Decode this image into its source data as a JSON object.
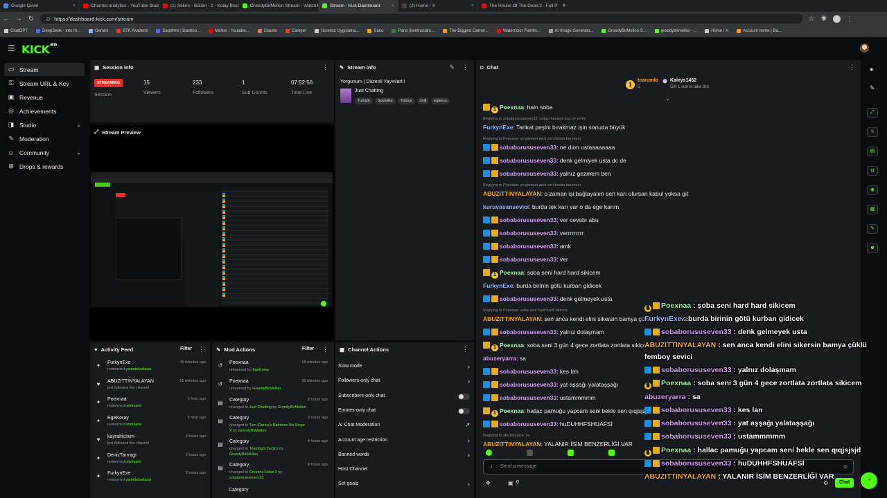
{
  "browser": {
    "tabs": [
      {
        "label": "Google Çeviri",
        "color": "#4285f4"
      },
      {
        "label": "Channel analytics - YouTube Studio",
        "color": "#ff0000"
      },
      {
        "label": "(1) Sekiro - Bölüm - 2 - Kolay Boss",
        "color": "#ff0000"
      },
      {
        "label": "GreedyBirMellon Stream - Watch L",
        "color": "#53fc18"
      },
      {
        "label": "Stream - Kick Dashboard",
        "color": "#53fc18"
      },
      {
        "label": "(2) Home / X",
        "color": "#444444"
      },
      {
        "label": "The House Of The Dead 2 - Full Pl",
        "color": "#ff0000"
      }
    ],
    "url": "https://dashboard.kick.com/stream",
    "bookmarks": [
      {
        "label": "ChatGPT",
        "color": "#cfcfcf"
      },
      {
        "label": "DeepSeek - Into th...",
        "color": "#4d6bfe"
      },
      {
        "label": "Gemini",
        "color": "#8ab4f8"
      },
      {
        "label": "BTK Akademi",
        "color": "#e53935"
      },
      {
        "label": "Sapphire | Dashbo...",
        "color": "#5865f2"
      },
      {
        "label": "Mellon - Youtube...",
        "color": "#ff0000"
      },
      {
        "label": "Claude",
        "color": "#d97757"
      },
      {
        "label": "Camper",
        "color": "#e53935"
      },
      {
        "label": "Ücretsiz Uygulama...",
        "color": "#cfcfcf"
      },
      {
        "label": "Suno",
        "color": "#f7a600"
      },
      {
        "label": "Pano (bentrendim...",
        "color": "#2e7d32"
      },
      {
        "label": "The Biggest Gamer...",
        "color": "#ff9800"
      },
      {
        "label": "Watercolor Paintin...",
        "color": "#ff0000"
      },
      {
        "label": "AI Image Generato...",
        "color": "#9e9e9e"
      },
      {
        "label": "GreedyBirMellon S...",
        "color": "#53fc18"
      },
      {
        "label": "greedybirmellon -...",
        "color": "#53fc18"
      },
      {
        "label": "Home / X",
        "color": "#cfcfcf"
      },
      {
        "label": "Account home | Ba...",
        "color": "#ff9800"
      }
    ]
  },
  "brand": {
    "logo": "KICK",
    "beta": "BETA",
    "accent": "#53fc18"
  },
  "sidebar": [
    {
      "label": "Stream",
      "icon": "stream-icon",
      "glyph": "▭"
    },
    {
      "label": "Stream URL & Key",
      "icon": "key-icon",
      "glyph": "⚿"
    },
    {
      "label": "Revenue",
      "icon": "revenue-icon",
      "glyph": "▣"
    },
    {
      "label": "Achievements",
      "icon": "achievements-icon",
      "glyph": "◎"
    },
    {
      "label": "Studio",
      "icon": "studio-icon",
      "glyph": "◨"
    },
    {
      "label": "Moderation",
      "icon": "moderation-icon",
      "glyph": "✎"
    },
    {
      "label": "Community",
      "icon": "community-icon",
      "glyph": "☺"
    },
    {
      "label": "Drops & rewards",
      "icon": "drops-icon",
      "glyph": "⊞"
    }
  ],
  "session": {
    "title": "Session Info",
    "badge": "STREAMING",
    "badge_label": "Session",
    "stats": [
      {
        "value": "15",
        "label": "Viewers"
      },
      {
        "value": "233",
        "label": "Followers"
      },
      {
        "value": "1",
        "label": "Sub Counts"
      },
      {
        "value": "07:52:56",
        "label": "Time Live"
      }
    ]
  },
  "stream_info": {
    "title": "Stream info",
    "stream_title": "Yorgunum | Düzenli Yayınlar!!!",
    "category": "Just Chatting",
    "tags": [
      "Turkish",
      "Soulslike",
      "Türkçe",
      "chill",
      "eglence"
    ]
  },
  "preview": {
    "title": "Stream Preview"
  },
  "activity": {
    "title": "Activity Feed",
    "filter": "Filter",
    "items": [
      {
        "name": "FurkynExe",
        "pre": "redeemed ",
        "hl": "yametekudasai",
        "time": "45 minutes ago",
        "icon": "redeem-icon",
        "glyph": "✦"
      },
      {
        "name": "ABUZITTINYALAYAN",
        "pre": "just followed the channel",
        "hl": "",
        "time": "55 minutes ago",
        "icon": "heart-icon",
        "glyph": "♥"
      },
      {
        "name": "Poexnaa",
        "pre": "redeemed ",
        "hl": "isteksarkı",
        "time": "1 hour ago",
        "icon": "redeem-icon",
        "glyph": "✦"
      },
      {
        "name": "EgeKoray",
        "pre": "redeemed ",
        "hl": "isteksarkı",
        "time": "1 hour ago",
        "icon": "redeem-icon",
        "glyph": "✦"
      },
      {
        "name": "kayralricsvm",
        "pre": "just followed the channel",
        "hl": "",
        "time": "2 hours ago",
        "icon": "heart-icon",
        "glyph": "♥"
      },
      {
        "name": "DenizTarrragi",
        "pre": "redeemed ",
        "hl": "isteksarkı",
        "time": "2 hours ago",
        "icon": "redeem-icon",
        "glyph": "✦"
      },
      {
        "name": "FurkynExe",
        "pre": "redeemed ",
        "hl": "yametekudasai",
        "time": "2 hours ago",
        "icon": "redeem-icon",
        "glyph": "✦"
      }
    ]
  },
  "mod_actions": {
    "title": "Mod Actions",
    "filter": "Filter",
    "items": [
      {
        "name": "Poexnaa",
        "line1": "unbanned by ",
        "hl1": "EgeKoray",
        "line2": "",
        "time": "18 minutes ago",
        "glyph": "↺"
      },
      {
        "name": "Poexnaa",
        "line1": "unbanned by ",
        "hl1": "GreedyBirMellon",
        "line2": "",
        "time": "30 minutes ago",
        "glyph": "↺"
      },
      {
        "name": "Category",
        "line1": "changed to ",
        "hl1": "Just Chatting",
        "mid": " by ",
        "hl2": "GreedyBirMellon",
        "time": "2 hours ago",
        "glyph": "▤"
      },
      {
        "name": "Category",
        "line1": "changed to ",
        "hl1": "Tom Clancy's Rainbow Six Siege X",
        "mid": " by ",
        "hl2": "GreedyBirMellon",
        "time": "3 hours ago",
        "glyph": "▤"
      },
      {
        "name": "Category",
        "line1": "changed to ",
        "hl1": "Teamfight Tactics",
        "mid": " by ",
        "hl2": "GreedyBirMellon",
        "time": "4 hours ago",
        "glyph": "▤"
      },
      {
        "name": "Category",
        "line1": "changed to ",
        "hl1": "Counter-Strike 2",
        "mid": " by ",
        "hl2": "sobaborususeven33",
        "time": "6 hours ago",
        "glyph": "▤"
      }
    ],
    "cut_item": "Category"
  },
  "channel_actions": {
    "title": "Channel Actions",
    "items": [
      {
        "label": "Slow mode",
        "ctl": "chevron"
      },
      {
        "label": "Followers-only chat",
        "ctl": "chevron"
      },
      {
        "label": "Subscribers-only chat",
        "ctl": "toggle"
      },
      {
        "label": "Emotes-only chat",
        "ctl": "toggle"
      },
      {
        "label": "AI Chat Moderation",
        "ctl": "link"
      },
      {
        "label": "Account age restriction",
        "ctl": "chevron"
      },
      {
        "label": "Banned words",
        "ctl": "chevron"
      },
      {
        "label": "Host Channel",
        "ctl": "none"
      },
      {
        "label": "Set goals",
        "ctl": "chevron"
      }
    ]
  },
  "chat": {
    "title": "Chat",
    "top_gifters": [
      {
        "name": "tearundo",
        "sub": "5"
      },
      {
        "name": "Kaleys1452",
        "sub": "Gift 1 sub to take 3rd"
      }
    ],
    "messages": [
      {
        "reply": "",
        "badges": [
          "gold",
          "yellow"
        ],
        "user": "Poexnaa",
        "color": "#9cf3a3",
        "text": ": hain soba"
      },
      {
        "reply": "Replying to sobaborususeven33: ustayı kesseni kaç yıl yerim",
        "badges": [],
        "user": "FurkynExe",
        "color": "#8fb3ff",
        "text": ": Tarikat peşini bırakmaz işin sonuda büyük"
      },
      {
        "reply": "Replying to Poexnaa: yo gitmem artık sen benim karımsın",
        "badges": [
          "blue",
          "gold"
        ],
        "user": "sobaborususeven33",
        "color": "#d49cf6",
        "text": ": ne dion ustaaaaaaaa"
      },
      {
        "reply": "",
        "badges": [
          "blue",
          "gold"
        ],
        "user": "sobaborususeven33",
        "color": "#d49cf6",
        "text": ": denk gelmiyek usta dc de"
      },
      {
        "reply": "",
        "badges": [
          "blue",
          "gold"
        ],
        "user": "sobaborususeven33",
        "color": "#d49cf6",
        "text": ": yalnız gezmem ben"
      },
      {
        "reply": "Replying to Poexnaa: yo gitmem artık sen benim karımsın",
        "badges": [],
        "user": "ABUZITTINYALAYAN",
        "color": "#f5a623",
        "text": ": o zaman işi bağlayalım sen karı olursan kabul yoksa git"
      },
      {
        "reply": "",
        "badges": [],
        "user": "kuruvasansevici",
        "color": "#8fb3ff",
        "text": ": burda tek karı var o da ege karım"
      },
      {
        "reply": "",
        "badges": [
          "blue",
          "gold"
        ],
        "user": "sobaborususeven33",
        "color": "#d49cf6",
        "text": ": ver cevabı abu"
      },
      {
        "reply": "",
        "badges": [
          "blue",
          "gold"
        ],
        "user": "sobaborususeven33",
        "color": "#d49cf6",
        "text": ": verrrrrrrrr"
      },
      {
        "reply": "",
        "badges": [
          "blue",
          "gold"
        ],
        "user": "sobaborususeven33",
        "color": "#d49cf6",
        "text": ": amk"
      },
      {
        "reply": "",
        "badges": [
          "blue",
          "gold"
        ],
        "user": "sobaborususeven33",
        "color": "#d49cf6",
        "text": ": ver"
      },
      {
        "reply": "",
        "badges": [
          "gold",
          "yellow"
        ],
        "user": "Poexnaa",
        "color": "#9cf3a3",
        "text": ": soba seni hard hard sikicem"
      },
      {
        "reply": "",
        "badges": [],
        "user": "FurkynExe",
        "color": "#8fb3ff",
        "text": ": burda birinin götü kurban gidicek"
      },
      {
        "reply": "",
        "badges": [
          "blue",
          "gold"
        ],
        "user": "sobaborususeven33",
        "color": "#d49cf6",
        "text": ": denk gelmeyek usta"
      },
      {
        "reply": "Replying to Poexnaa: soba seni hard hard sikicem",
        "badges": [],
        "user": "ABUZITTINYALAYAN",
        "color": "#f5a623",
        "text": ": sen anca kendi elini sikersin bamya çüklü femboy sevici"
      },
      {
        "reply": "",
        "badges": [
          "blue",
          "gold"
        ],
        "user": "sobaborususeven33",
        "color": "#d49cf6",
        "text": ": yalnız dolaşmam"
      },
      {
        "reply": "",
        "badges": [
          "gold",
          "yellow"
        ],
        "user": "Poexnaa",
        "color": "#9cf3a3",
        "text": ": soba seni 3 gün 4 gece zortlata zortlata sikicem"
      },
      {
        "reply": "",
        "badges": [],
        "user": "abuzeryarra",
        "color": "#d49cf6",
        "text": ": sa"
      },
      {
        "reply": "",
        "badges": [
          "blue",
          "gold"
        ],
        "user": "sobaborususeven33",
        "color": "#d49cf6",
        "text": ": kes lan"
      },
      {
        "reply": "",
        "badges": [
          "blue",
          "gold"
        ],
        "user": "sobaborususeven33",
        "color": "#d49cf6",
        "text": ": yat aşşağı yalataşşağı"
      },
      {
        "reply": "",
        "badges": [
          "blue",
          "gold"
        ],
        "user": "sobaborususeven33",
        "color": "#d49cf6",
        "text": ": ustammmmm"
      },
      {
        "reply": "",
        "badges": [
          "gold",
          "yellow"
        ],
        "user": "Poexnaa",
        "color": "#9cf3a3",
        "text": ": hallac pamuğu yapcam seni bekle sen qıqjsjsjd"
      },
      {
        "reply": "",
        "badges": [
          "blue",
          "gold"
        ],
        "user": "sobaborususeven33",
        "color": "#d49cf6",
        "text": ": huDUHHFSHUAFSİ"
      },
      {
        "reply": "Replying to abuzeryarra: sa",
        "badges": [],
        "user": "ABUZITTINYALAYAN",
        "color": "#f5a623",
        "text": ": YALANIR İSİM BENZERLİĞİ VAR"
      }
    ],
    "input_placeholder": "Send a message",
    "send_label": "Chat",
    "footer_count": "0"
  },
  "overlay": [
    {
      "badges": [
        "yellow",
        "gold"
      ],
      "user": "Poexnaa",
      "color": "#9cf3a3",
      "text": " : soba seni hard hard sikicem"
    },
    {
      "badges": [],
      "user": "FurkynExe",
      "color": "#8fb3ff",
      "text": " : burda birinin götü kurban gidicek"
    },
    {
      "badges": [
        "blue",
        "gold"
      ],
      "user": "sobaborususeven33",
      "color": "#d49cf6",
      "text": " : denk gelmeyek usta"
    },
    {
      "badges": [],
      "user": "ABUZITTINYALAYAN",
      "color": "#f5a623",
      "text": " : sen anca kendi elini sikersin bamya çüklü"
    },
    {
      "badges": [],
      "user": "",
      "color": "#ffffff",
      "text": "femboy sevici"
    },
    {
      "badges": [
        "blue",
        "gold"
      ],
      "user": "sobaborususeven33",
      "color": "#d49cf6",
      "text": " : yalnız dolaşmam"
    },
    {
      "badges": [
        "yellow",
        "gold"
      ],
      "user": "Poexnaa",
      "color": "#9cf3a3",
      "text": " : soba seni 3 gün 4 gece zortlata zortlata sikicem"
    },
    {
      "badges": [],
      "user": "abuzeryarra",
      "color": "#d49cf6",
      "text": " : sa"
    },
    {
      "badges": [
        "blue",
        "gold"
      ],
      "user": "sobaborususeven33",
      "color": "#d49cf6",
      "text": " : kes lan"
    },
    {
      "badges": [
        "blue",
        "gold"
      ],
      "user": "sobaborususeven33",
      "color": "#d49cf6",
      "text": " : yat aşşağı yalataşşağı"
    },
    {
      "badges": [
        "blue",
        "gold"
      ],
      "user": "sobaborususeven33",
      "color": "#d49cf6",
      "text": " : ustammmmm"
    },
    {
      "badges": [
        "yellow",
        "gold"
      ],
      "user": "Poexnaa",
      "color": "#9cf3a3",
      "text": " : hallac pamuğu yapcam seni bekle sen qıqjsjsjd"
    },
    {
      "badges": [
        "blue",
        "gold"
      ],
      "user": "sobaborususeven33",
      "color": "#d49cf6",
      "text": " : huDUHHFSHUAFSİ"
    },
    {
      "badges": [],
      "user": "ABUZITTINYALAYAN",
      "color": "#f5a623",
      "text": " : YALANIR İSİM BENZERLİĞİ VAR"
    }
  ],
  "right_rail": [
    {
      "icon": "expand-icon",
      "glyph": "⤢"
    },
    {
      "icon": "bolt-icon",
      "glyph": "ϟ"
    },
    {
      "icon": "clipboard-icon",
      "glyph": "▤"
    },
    {
      "icon": "chat-bubble-icon",
      "glyph": "◘"
    },
    {
      "icon": "broadcast-icon",
      "glyph": "◉"
    },
    {
      "icon": "calendar-icon",
      "glyph": "▦"
    },
    {
      "icon": "wrench-icon",
      "glyph": "✎"
    },
    {
      "icon": "people-icon",
      "glyph": "☻"
    }
  ]
}
